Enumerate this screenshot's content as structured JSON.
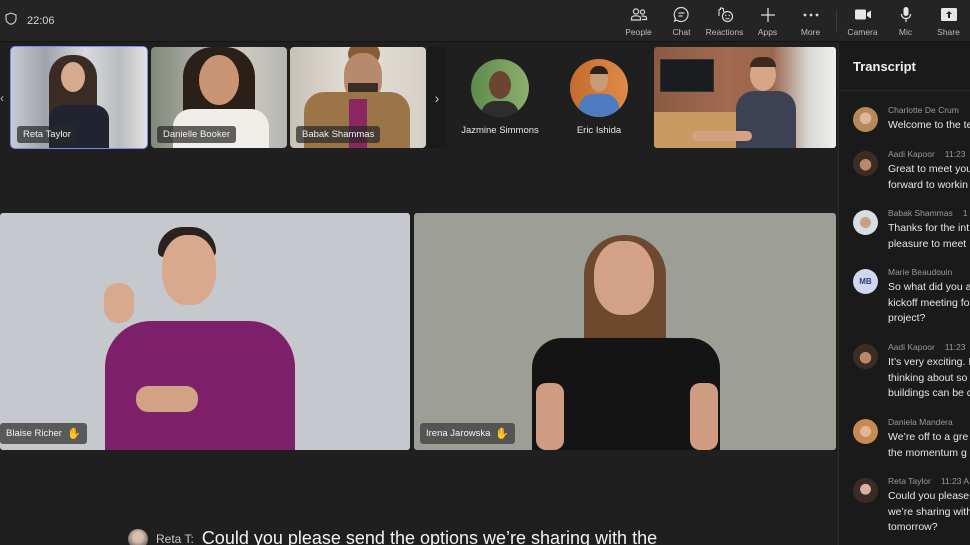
{
  "status": {
    "clock": "22:06"
  },
  "toolbar": {
    "items": [
      {
        "label": "People",
        "icon": "people-icon"
      },
      {
        "label": "Chat",
        "icon": "chat-icon"
      },
      {
        "label": "Reactions",
        "icon": "reactions-icon"
      },
      {
        "label": "Apps",
        "icon": "plus-icon"
      },
      {
        "label": "More",
        "icon": "more-icon"
      }
    ],
    "device_items": [
      {
        "label": "Camera",
        "icon": "camera-icon"
      },
      {
        "label": "Mic",
        "icon": "mic-icon"
      },
      {
        "label": "Share",
        "icon": "share-icon"
      }
    ]
  },
  "gallery": {
    "video_tiles": [
      {
        "name": "Reta Taylor",
        "active": true
      },
      {
        "name": "Danielle Booker",
        "active": false
      },
      {
        "name": "Babak Shammas",
        "active": false
      }
    ],
    "avatar_tiles": [
      {
        "name": "Jazmine Simmons"
      },
      {
        "name": "Eric Ishida"
      }
    ],
    "extra_tile": {
      "name": ""
    }
  },
  "stage": {
    "tiles": [
      {
        "name": "Blaise Richer",
        "hand_raised": true
      },
      {
        "name": "Irena Jarowska",
        "hand_raised": true
      }
    ]
  },
  "caption": {
    "speaker": "Reta T:",
    "text": "Could you please send the options we’re sharing with the"
  },
  "transcript": {
    "title": "Transcript",
    "entries": [
      {
        "name": "Charlotte De Crum",
        "time": "",
        "lines": [
          "Welcome to the te"
        ]
      },
      {
        "name": "Aadi Kapoor",
        "time": "11:23",
        "lines": [
          "Great to meet you",
          "forward to workin"
        ]
      },
      {
        "name": "Babak Shammas",
        "time": "1",
        "lines": [
          "Thanks for the int",
          "pleasure to meet"
        ]
      },
      {
        "name": "Marie Beaudouin",
        "time": "",
        "initials": "MB",
        "lines": [
          "So what did you a",
          "kickoff meeting fo",
          "project?"
        ]
      },
      {
        "name": "Aadi Kapoor",
        "time": "11:23",
        "lines": [
          "It’s very exciting. I",
          "thinking about so",
          "buildings can be c"
        ]
      },
      {
        "name": "Daniela Mandera",
        "time": "",
        "lines": [
          "We’re off to a gre",
          "the momentum g"
        ]
      },
      {
        "name": "Reta Taylor",
        "time": "11:23 A",
        "lines": [
          "Could you please",
          "we’re sharing with",
          "tomorrow?"
        ]
      }
    ]
  },
  "colors": {
    "accent": "#7f85f5",
    "background": "#1f1f1f",
    "panel": "#1a1a1a"
  }
}
